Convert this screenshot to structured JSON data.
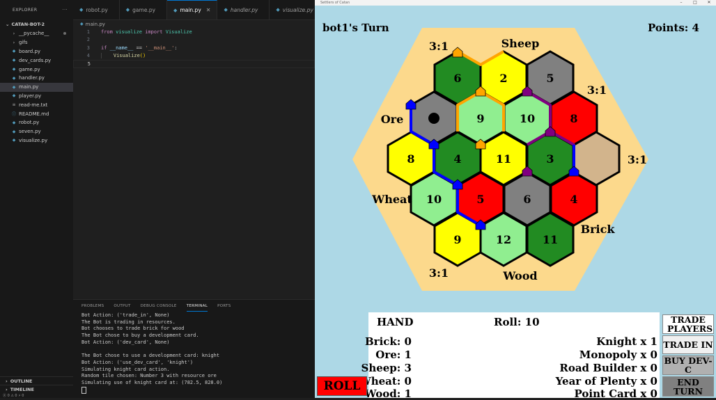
{
  "explorer": {
    "header": "EXPLORER",
    "more": "···",
    "project": "CATAN-BOT-2",
    "items": [
      {
        "label": "__pycache__",
        "type": "folder"
      },
      {
        "label": "gifs",
        "type": "folder"
      },
      {
        "label": "board.py",
        "type": "py"
      },
      {
        "label": "dev_cards.py",
        "type": "py"
      },
      {
        "label": "game.py",
        "type": "py"
      },
      {
        "label": "handler.py",
        "type": "py"
      },
      {
        "label": "main.py",
        "type": "py",
        "active": true
      },
      {
        "label": "player.py",
        "type": "py"
      },
      {
        "label": "read-me.txt",
        "type": "txt"
      },
      {
        "label": "README.md",
        "type": "md"
      },
      {
        "label": "robot.py",
        "type": "py"
      },
      {
        "label": "seven.py",
        "type": "py"
      },
      {
        "label": "visualize.py",
        "type": "py"
      }
    ],
    "outline": "OUTLINE",
    "timeline": "TIMELINE"
  },
  "tabs": [
    {
      "label": "robot.py",
      "active": false,
      "italic": false
    },
    {
      "label": "game.py",
      "active": false,
      "italic": false
    },
    {
      "label": "main.py",
      "active": true,
      "italic": false
    },
    {
      "label": "handler.py",
      "active": false,
      "italic": true
    },
    {
      "label": "visualize.py",
      "active": false,
      "italic": true
    }
  ],
  "breadcrumb": "main.py",
  "code": {
    "line_numbers": [
      "1",
      "2",
      "3",
      "4",
      "5"
    ],
    "l1": {
      "from": "from",
      "module": "visualize",
      "import": "import",
      "name": "Visualize"
    },
    "l3": {
      "if": "if",
      "var": "__name__",
      "op": "==",
      "str": "'__main__'",
      "colon": ":"
    },
    "l4": {
      "call": "Visualize",
      "parens": "()"
    }
  },
  "panel": {
    "tabs": [
      "PROBLEMS",
      "OUTPUT",
      "DEBUG CONSOLE",
      "TERMINAL",
      "PORTS"
    ],
    "active_tab": "TERMINAL",
    "lines": [
      "Bot Action: ('trade_in', None)",
      "The Bot is trading in resources.",
      "Bot chooses to trade brick for wood",
      "The Bot chose to buy a development card.",
      "Bot Action: ('dev_card', None)",
      "",
      "The Bot chose to use a development card: knight",
      "Bot Action: ('use_dev_card', 'knight')",
      "Simulating knight card action.",
      "Random tile chosen: Number 3 with resource ore",
      "Simulating use of knight card at: (782.5, 828.0)"
    ]
  },
  "statusbar": "Ⓧ 0 ⚠ 0   ⚡ 0",
  "game": {
    "window_title": "Settlers of Catan",
    "turn": "bot1's Turn",
    "points": "Points: 4",
    "colors": {
      "ocean": "#add8e6",
      "sand": "#fcd98c",
      "forest": "#228b22",
      "pasture": "#90ee90",
      "fields": "#ffff00",
      "hills": "#ff0000",
      "mountains": "#808080",
      "desert": "#d2b48c",
      "orange": "#ffa500",
      "purple": "#800080",
      "blue": "#0000ff"
    },
    "tiles": [
      {
        "number": "6",
        "resource": "forest"
      },
      {
        "number": "2",
        "resource": "fields"
      },
      {
        "number": "5",
        "resource": "mountains"
      },
      {
        "number": "",
        "resource": "mountains",
        "robber": true
      },
      {
        "number": "9",
        "resource": "pasture"
      },
      {
        "number": "10",
        "resource": "pasture"
      },
      {
        "number": "8",
        "resource": "hills"
      },
      {
        "number": "8",
        "resource": "fields"
      },
      {
        "number": "4",
        "resource": "forest"
      },
      {
        "number": "11",
        "resource": "fields"
      },
      {
        "number": "3",
        "resource": "forest"
      },
      {
        "number": "",
        "resource": "desert"
      },
      {
        "number": "10",
        "resource": "pasture"
      },
      {
        "number": "5",
        "resource": "hills"
      },
      {
        "number": "6",
        "resource": "mountains"
      },
      {
        "number": "4",
        "resource": "hills"
      },
      {
        "number": "9",
        "resource": "fields"
      },
      {
        "number": "12",
        "resource": "pasture"
      },
      {
        "number": "11",
        "resource": "forest"
      }
    ],
    "ports": {
      "p1": "3:1",
      "p2": "Sheep",
      "p3": "3:1",
      "p4": "Ore",
      "p5": "3:1",
      "p6": "Wheat",
      "p7": "Brick",
      "p8": "3:1",
      "p9": "Wood"
    },
    "hand": {
      "title": "HAND",
      "roll": "Roll: 10",
      "resources": [
        "Brick: 0",
        "Ore: 1",
        "Sheep: 3",
        "Wheat: 0",
        "Wood: 1"
      ],
      "dev_cards": [
        "Knight x 1",
        "Monopoly x 0",
        "Road Builder x 0",
        "Year of Plenty x 0",
        "Point Card x 0"
      ]
    },
    "buttons": {
      "trade_players": "TRADE PLAYERS",
      "trade_in": "TRADE IN",
      "buy_dev": "BUY DEV-C",
      "end_turn": "END TURN",
      "roll": "ROLL"
    }
  }
}
